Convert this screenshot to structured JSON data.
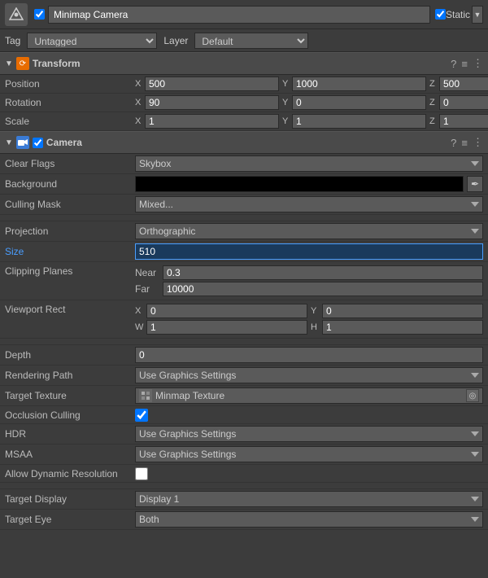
{
  "topbar": {
    "object_name": "Minimap Camera",
    "static_label": "Static",
    "checkbox_checked": true
  },
  "tag_layer": {
    "tag_label": "Tag",
    "tag_value": "Untagged",
    "layer_label": "Layer",
    "layer_value": "Default"
  },
  "transform": {
    "header_title": "Transform",
    "position_label": "Position",
    "pos_x": "500",
    "pos_y": "1000",
    "pos_z": "500",
    "rotation_label": "Rotation",
    "rot_x": "90",
    "rot_y": "0",
    "rot_z": "0",
    "scale_label": "Scale",
    "scale_x": "1",
    "scale_y": "1",
    "scale_z": "1"
  },
  "camera": {
    "header_title": "Camera",
    "clear_flags_label": "Clear Flags",
    "clear_flags_value": "Skybox",
    "background_label": "Background",
    "culling_mask_label": "Culling Mask",
    "culling_mask_value": "Mixed...",
    "projection_label": "Projection",
    "projection_value": "Orthographic",
    "size_label": "Size",
    "size_value": "510",
    "clipping_label": "Clipping Planes",
    "near_label": "Near",
    "near_value": "0.3",
    "far_label": "Far",
    "far_value": "10000",
    "viewport_label": "Viewport Rect",
    "vp_x": "0",
    "vp_y": "0",
    "vp_w": "1",
    "vp_h": "1",
    "depth_label": "Depth",
    "depth_value": "0",
    "rendering_label": "Rendering Path",
    "rendering_value": "Use Graphics Settings",
    "target_texture_label": "Target Texture",
    "target_texture_value": "Minmap Texture",
    "occlusion_label": "Occlusion Culling",
    "hdr_label": "HDR",
    "hdr_value": "Use Graphics Settings",
    "msaa_label": "MSAA",
    "msaa_value": "Use Graphics Settings",
    "allow_dynamic_label": "Allow Dynamic Resolution",
    "target_display_label": "Target Display",
    "target_display_value": "Display 1",
    "target_eye_label": "Target Eye",
    "target_eye_value": "Both"
  },
  "icons": {
    "question_mark": "?",
    "settings": "≡",
    "overflow": "⋮",
    "arrow_down": "▼",
    "arrow_right": "▶",
    "eyedropper": "✒",
    "circle_dot": "◎"
  }
}
